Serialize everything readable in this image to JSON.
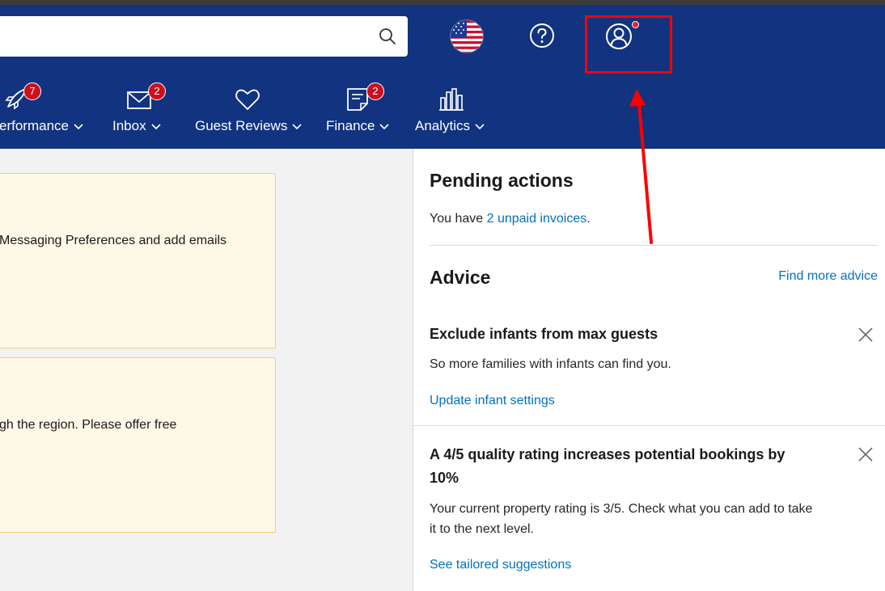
{
  "header": {
    "search_placeholder": "",
    "nav": [
      {
        "label": "erformance",
        "badge": "7"
      },
      {
        "label": "Inbox",
        "badge": "2"
      },
      {
        "label": "Guest Reviews",
        "badge": ""
      },
      {
        "label": "Finance",
        "badge": "2"
      },
      {
        "label": "Analytics",
        "badge": ""
      }
    ]
  },
  "cards": [
    {
      "text": "Messaging Preferences and add emails"
    },
    {
      "text": "gh the region. Please offer free"
    }
  ],
  "pending": {
    "title": "Pending actions",
    "prefix": "You have ",
    "link": "2 unpaid invoices",
    "suffix": "."
  },
  "advice": {
    "title": "Advice",
    "more_link": "Find more advice",
    "items": [
      {
        "title": "Exclude infants from max guests",
        "body": "So more families with infants can find you.",
        "link": "Update infant settings"
      },
      {
        "title_line1": "A 4/5 quality rating increases potential bookings by",
        "title_line2": "10%",
        "body_line1": "Your current property rating is 3/5. Check what you can add to take",
        "body_line2": "it to the next level.",
        "link": "See tailored suggestions"
      }
    ]
  },
  "colors": {
    "header_bg": "#113380",
    "link": "#0071c2",
    "badge": "#cc0f1e",
    "annotation": "#ff0000"
  }
}
